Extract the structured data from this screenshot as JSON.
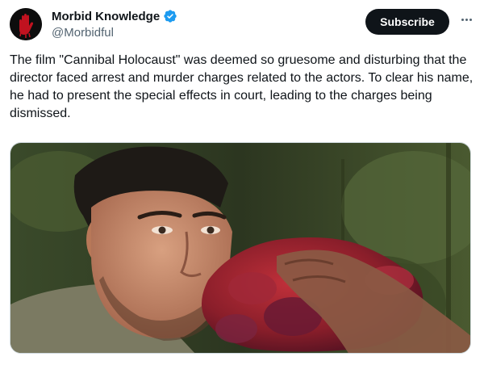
{
  "author": {
    "display_name": "Morbid Knowledge",
    "handle": "@Morbidful",
    "verified": true,
    "avatar_icon": "bloody-hand-icon"
  },
  "actions": {
    "subscribe_label": "Subscribe",
    "more_icon": "more-options-icon"
  },
  "tweet": {
    "text": "The film \"Cannibal Holocaust\" was deemed so gruesome and disturbing that the director faced arrest and murder charges related to the actors. To clear his name, he had to present the special effects in court, leading to the charges being dismissed."
  },
  "colors": {
    "text_primary": "#0f1419",
    "text_secondary": "#536471",
    "verified_blue": "#1d9bf0",
    "button_bg": "#0f1419"
  }
}
